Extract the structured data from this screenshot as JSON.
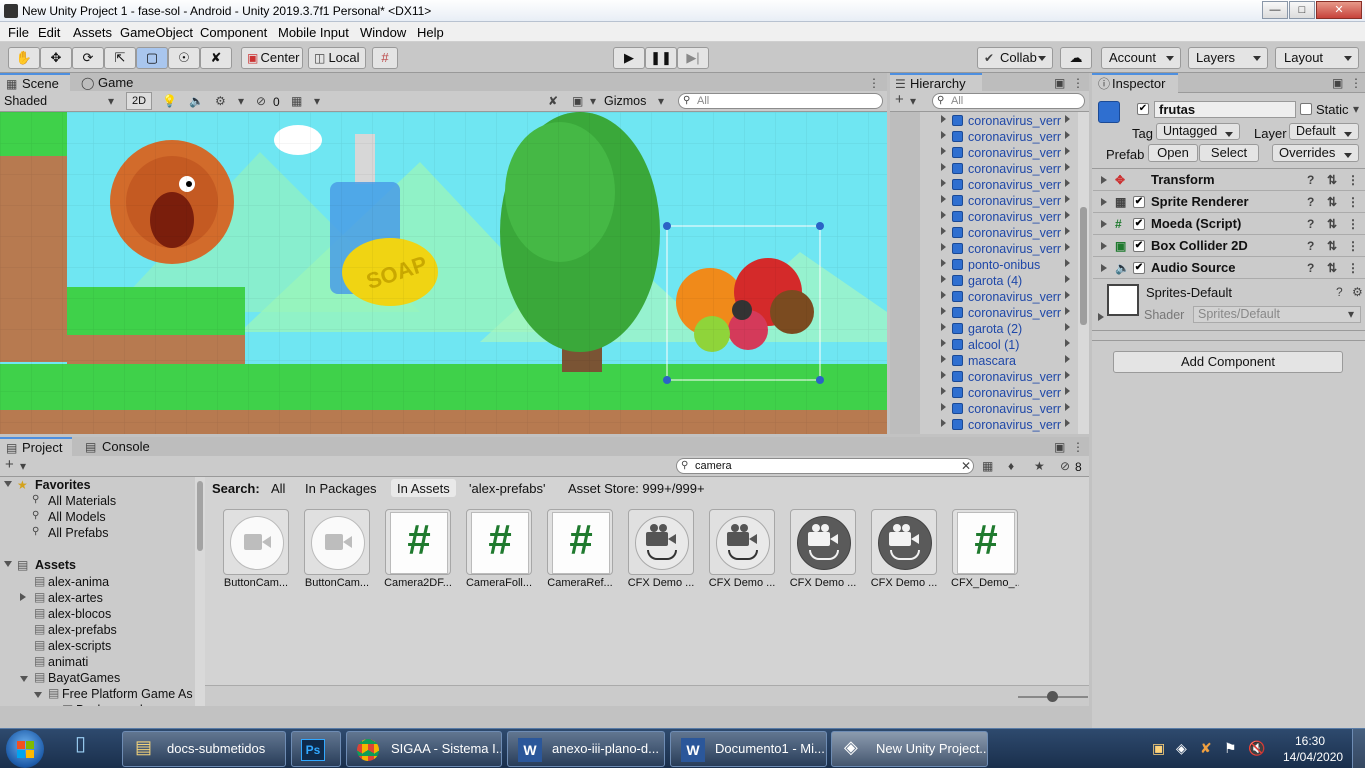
{
  "window": {
    "title": "New Unity Project 1 - fase-sol - Android - Unity 2019.3.7f1 Personal* <DX11>"
  },
  "menu": [
    "File",
    "Edit",
    "Assets",
    "GameObject",
    "Component",
    "Mobile Input",
    "Window",
    "Help"
  ],
  "toolbar": {
    "center": "Center",
    "local": "Local",
    "collab": "Collab",
    "account": "Account",
    "layers": "Layers",
    "layout": "Layout"
  },
  "scene": {
    "tabs": {
      "scene": "Scene",
      "game": "Game"
    },
    "shading": "Shaded",
    "mode2d": "2D",
    "hidden_count": "0",
    "gizmos": "Gizmos",
    "search_placeholder": "All"
  },
  "hierarchy": {
    "tab": "Hierarchy",
    "search_placeholder": "All",
    "items": [
      "coronavirus_verr",
      "coronavirus_verr",
      "coronavirus_verr",
      "coronavirus_verr",
      "coronavirus_verr",
      "coronavirus_verr",
      "coronavirus_verr",
      "coronavirus_verr",
      "coronavirus_verr",
      "ponto-onibus",
      "garota (4)",
      "coronavirus_verr",
      "coronavirus_verr",
      "garota (2)",
      "alcool (1)",
      "mascara",
      "coronavirus_verr",
      "coronavirus_verr",
      "coronavirus_verr",
      "coronavirus_verr"
    ]
  },
  "inspector": {
    "tab": "Inspector",
    "object_name": "frutas",
    "static": "Static",
    "tag_label": "Tag",
    "tag_value": "Untagged",
    "layer_label": "Layer",
    "layer_value": "Default",
    "prefab_label": "Prefab",
    "open": "Open",
    "select": "Select",
    "overrides": "Overrides",
    "components": [
      "Transform",
      "Sprite Renderer",
      "Moeda (Script)",
      "Box Collider 2D",
      "Audio Source"
    ],
    "material_name": "Sprites-Default",
    "shader_label": "Shader",
    "shader_value": "Sprites/Default",
    "add_component": "Add Component"
  },
  "project": {
    "tabs": {
      "project": "Project",
      "console": "Console"
    },
    "search_value": "camera",
    "hidden_count": "8",
    "search_label": "Search:",
    "filters": [
      "All",
      "In Packages",
      "In Assets",
      "'alex-prefabs'",
      "Asset Store: 999+/999+"
    ],
    "favorites": {
      "title": "Favorites",
      "items": [
        "All Materials",
        "All Models",
        "All Prefabs"
      ]
    },
    "assets_root": "Assets",
    "folders": [
      "alex-anima",
      "alex-artes",
      "alex-blocos",
      "alex-prefabs",
      "alex-scripts",
      "animati",
      "BayatGames",
      "Free Platform Game As",
      "Backgrounds"
    ],
    "results": [
      {
        "name": "ButtonCam...",
        "kind": "video"
      },
      {
        "name": "ButtonCam...",
        "kind": "video"
      },
      {
        "name": "Camera2DF...",
        "kind": "script"
      },
      {
        "name": "CameraFoll...",
        "kind": "script"
      },
      {
        "name": "CameraRef...",
        "kind": "script"
      },
      {
        "name": "CFX Demo ...",
        "kind": "camera-light"
      },
      {
        "name": "CFX Demo ...",
        "kind": "camera-light"
      },
      {
        "name": "CFX Demo ...",
        "kind": "camera-dark"
      },
      {
        "name": "CFX Demo ...",
        "kind": "camera-dark"
      },
      {
        "name": "CFX_Demo_...",
        "kind": "script"
      }
    ]
  },
  "taskbar": {
    "items": [
      "docs-submetidos",
      "",
      "SIGAA - Sistema I...",
      "anexo-iii-plano-d...",
      "Documento1 - Mi...",
      "New Unity Project..."
    ],
    "time": "16:30",
    "date": "14/04/2020"
  },
  "colors": {
    "accent": "#4d8fe0",
    "hierarchy_prefab": "#1f48a8",
    "script_hash": "#1f7a2e",
    "sky": "#6fe6f2",
    "grass": "#3fd14a"
  }
}
